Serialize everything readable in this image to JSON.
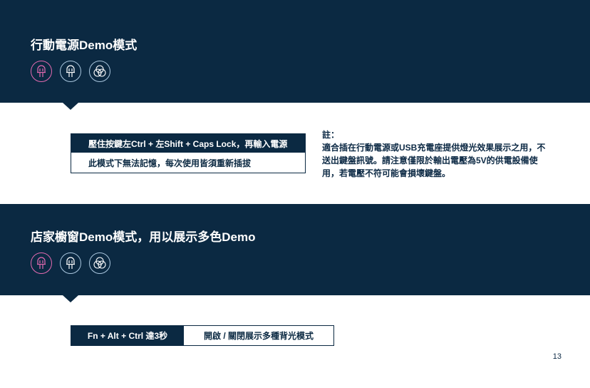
{
  "section1": {
    "title": "行動電源Demo模式",
    "icons": [
      "led-icon",
      "led-icon",
      "rgb-circles-icon"
    ],
    "instruction_line1": "壓住按鍵左Ctrl + 左Shift + Caps Lock，再輸入電源",
    "instruction_line2": "此模式下無法記憶，每次使用皆須重新插拔",
    "note_title": "註：",
    "note_body": "適合插在行動電源或USB充電座提供燈光效果展示之用，不送出鍵盤訊號。請注意僅限於輸出電壓為5V的供電設備使用，若電壓不符可能會損壞鍵盤。"
  },
  "section2": {
    "title": "店家櫥窗Demo模式，用以展示多色Demo",
    "icons": [
      "led-icon",
      "led-icon",
      "rgb-circles-icon"
    ],
    "key_combo": "Fn + Alt + Ctrl 達3秒",
    "action": "開啟 / 關閉展示多種背光模式"
  },
  "page_number": "13",
  "colors": {
    "navy": "#0b2942",
    "pink": "#e36ab0",
    "light_blue": "#a9c6de"
  }
}
